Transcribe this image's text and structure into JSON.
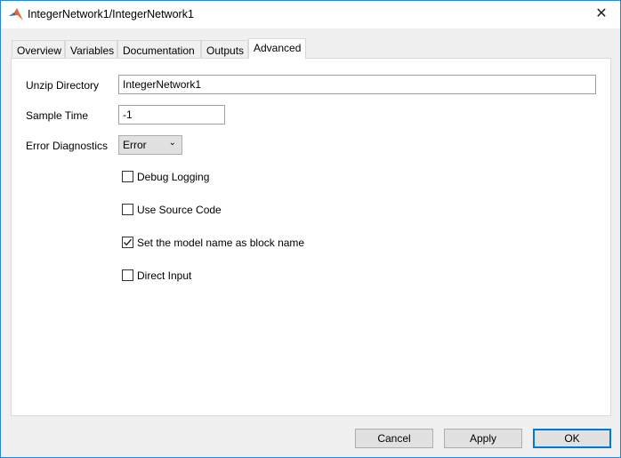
{
  "window": {
    "title": "IntegerNetwork1/IntegerNetwork1",
    "close_icon": "close-icon"
  },
  "tabs": [
    {
      "label": "Overview"
    },
    {
      "label": "Variables"
    },
    {
      "label": "Documentation"
    },
    {
      "label": "Outputs"
    },
    {
      "label": "Advanced",
      "selected": true
    }
  ],
  "form": {
    "unzip_label": "Unzip Directory",
    "unzip_value": "IntegerNetwork1",
    "sample_label": "Sample Time",
    "sample_value": "-1",
    "diag_label": "Error Diagnostics",
    "diag_value": "Error",
    "checkboxes": [
      {
        "label": "Debug Logging",
        "checked": false
      },
      {
        "label": "Use Source Code",
        "checked": false
      },
      {
        "label": "Set the model name as block name",
        "checked": true
      },
      {
        "label": "Direct Input",
        "checked": false
      }
    ]
  },
  "buttons": {
    "cancel": "Cancel",
    "apply": "Apply",
    "ok": "OK"
  }
}
